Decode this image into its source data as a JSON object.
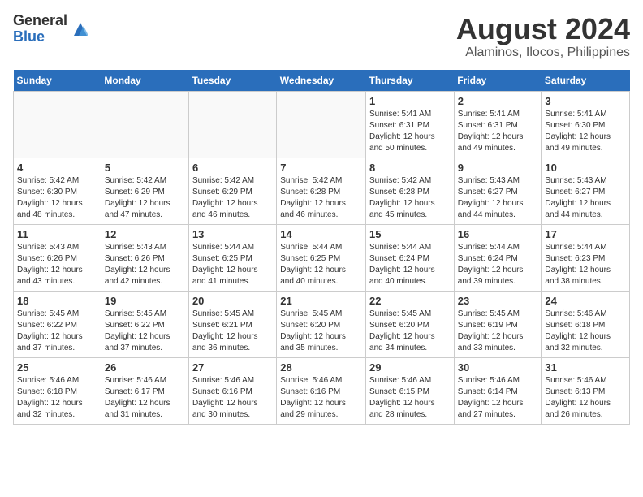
{
  "logo": {
    "general": "General",
    "blue": "Blue"
  },
  "title": "August 2024",
  "location": "Alaminos, Ilocos, Philippines",
  "days_header": [
    "Sunday",
    "Monday",
    "Tuesday",
    "Wednesday",
    "Thursday",
    "Friday",
    "Saturday"
  ],
  "weeks": [
    [
      {
        "day": "",
        "info": ""
      },
      {
        "day": "",
        "info": ""
      },
      {
        "day": "",
        "info": ""
      },
      {
        "day": "",
        "info": ""
      },
      {
        "day": "1",
        "info": "Sunrise: 5:41 AM\nSunset: 6:31 PM\nDaylight: 12 hours\nand 50 minutes."
      },
      {
        "day": "2",
        "info": "Sunrise: 5:41 AM\nSunset: 6:31 PM\nDaylight: 12 hours\nand 49 minutes."
      },
      {
        "day": "3",
        "info": "Sunrise: 5:41 AM\nSunset: 6:30 PM\nDaylight: 12 hours\nand 49 minutes."
      }
    ],
    [
      {
        "day": "4",
        "info": "Sunrise: 5:42 AM\nSunset: 6:30 PM\nDaylight: 12 hours\nand 48 minutes."
      },
      {
        "day": "5",
        "info": "Sunrise: 5:42 AM\nSunset: 6:29 PM\nDaylight: 12 hours\nand 47 minutes."
      },
      {
        "day": "6",
        "info": "Sunrise: 5:42 AM\nSunset: 6:29 PM\nDaylight: 12 hours\nand 46 minutes."
      },
      {
        "day": "7",
        "info": "Sunrise: 5:42 AM\nSunset: 6:28 PM\nDaylight: 12 hours\nand 46 minutes."
      },
      {
        "day": "8",
        "info": "Sunrise: 5:42 AM\nSunset: 6:28 PM\nDaylight: 12 hours\nand 45 minutes."
      },
      {
        "day": "9",
        "info": "Sunrise: 5:43 AM\nSunset: 6:27 PM\nDaylight: 12 hours\nand 44 minutes."
      },
      {
        "day": "10",
        "info": "Sunrise: 5:43 AM\nSunset: 6:27 PM\nDaylight: 12 hours\nand 44 minutes."
      }
    ],
    [
      {
        "day": "11",
        "info": "Sunrise: 5:43 AM\nSunset: 6:26 PM\nDaylight: 12 hours\nand 43 minutes."
      },
      {
        "day": "12",
        "info": "Sunrise: 5:43 AM\nSunset: 6:26 PM\nDaylight: 12 hours\nand 42 minutes."
      },
      {
        "day": "13",
        "info": "Sunrise: 5:44 AM\nSunset: 6:25 PM\nDaylight: 12 hours\nand 41 minutes."
      },
      {
        "day": "14",
        "info": "Sunrise: 5:44 AM\nSunset: 6:25 PM\nDaylight: 12 hours\nand 40 minutes."
      },
      {
        "day": "15",
        "info": "Sunrise: 5:44 AM\nSunset: 6:24 PM\nDaylight: 12 hours\nand 40 minutes."
      },
      {
        "day": "16",
        "info": "Sunrise: 5:44 AM\nSunset: 6:24 PM\nDaylight: 12 hours\nand 39 minutes."
      },
      {
        "day": "17",
        "info": "Sunrise: 5:44 AM\nSunset: 6:23 PM\nDaylight: 12 hours\nand 38 minutes."
      }
    ],
    [
      {
        "day": "18",
        "info": "Sunrise: 5:45 AM\nSunset: 6:22 PM\nDaylight: 12 hours\nand 37 minutes."
      },
      {
        "day": "19",
        "info": "Sunrise: 5:45 AM\nSunset: 6:22 PM\nDaylight: 12 hours\nand 37 minutes."
      },
      {
        "day": "20",
        "info": "Sunrise: 5:45 AM\nSunset: 6:21 PM\nDaylight: 12 hours\nand 36 minutes."
      },
      {
        "day": "21",
        "info": "Sunrise: 5:45 AM\nSunset: 6:20 PM\nDaylight: 12 hours\nand 35 minutes."
      },
      {
        "day": "22",
        "info": "Sunrise: 5:45 AM\nSunset: 6:20 PM\nDaylight: 12 hours\nand 34 minutes."
      },
      {
        "day": "23",
        "info": "Sunrise: 5:45 AM\nSunset: 6:19 PM\nDaylight: 12 hours\nand 33 minutes."
      },
      {
        "day": "24",
        "info": "Sunrise: 5:46 AM\nSunset: 6:18 PM\nDaylight: 12 hours\nand 32 minutes."
      }
    ],
    [
      {
        "day": "25",
        "info": "Sunrise: 5:46 AM\nSunset: 6:18 PM\nDaylight: 12 hours\nand 32 minutes."
      },
      {
        "day": "26",
        "info": "Sunrise: 5:46 AM\nSunset: 6:17 PM\nDaylight: 12 hours\nand 31 minutes."
      },
      {
        "day": "27",
        "info": "Sunrise: 5:46 AM\nSunset: 6:16 PM\nDaylight: 12 hours\nand 30 minutes."
      },
      {
        "day": "28",
        "info": "Sunrise: 5:46 AM\nSunset: 6:16 PM\nDaylight: 12 hours\nand 29 minutes."
      },
      {
        "day": "29",
        "info": "Sunrise: 5:46 AM\nSunset: 6:15 PM\nDaylight: 12 hours\nand 28 minutes."
      },
      {
        "day": "30",
        "info": "Sunrise: 5:46 AM\nSunset: 6:14 PM\nDaylight: 12 hours\nand 27 minutes."
      },
      {
        "day": "31",
        "info": "Sunrise: 5:46 AM\nSunset: 6:13 PM\nDaylight: 12 hours\nand 26 minutes."
      }
    ]
  ]
}
